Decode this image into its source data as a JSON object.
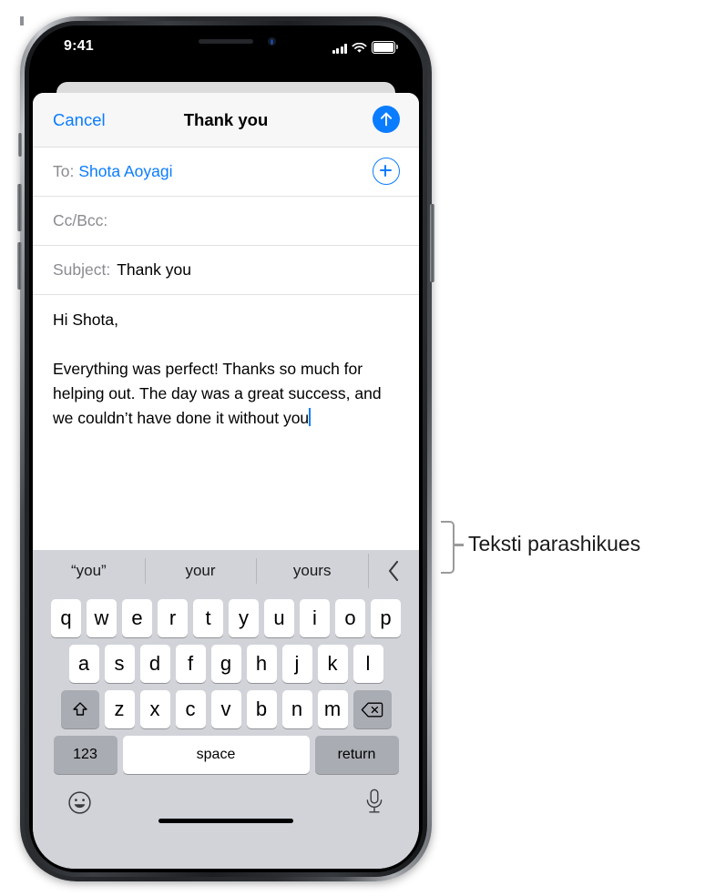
{
  "status_bar": {
    "time": "9:41",
    "signal_icon": "cellular-signal-icon",
    "wifi_icon": "wifi-icon",
    "battery_icon": "battery-icon"
  },
  "navbar": {
    "cancel_label": "Cancel",
    "title": "Thank you",
    "send_icon": "send-arrow-up-icon"
  },
  "fields": {
    "to_label": "To:",
    "to_value": "Shota Aoyagi",
    "add_contact_icon": "add-contact-plus-icon",
    "cc_label": "Cc/Bcc:",
    "cc_value": "",
    "subject_label": "Subject:",
    "subject_value": "Thank you"
  },
  "body": {
    "text": "Hi Shota,\n\nEverything was perfect! Thanks so much for helping out. The day was a great success, and we couldn’t have done it without you"
  },
  "keyboard": {
    "predictions": [
      "“you”",
      "your",
      "yours"
    ],
    "collapse_icon": "chevron-left-icon",
    "row1": [
      "q",
      "w",
      "e",
      "r",
      "t",
      "y",
      "u",
      "i",
      "o",
      "p"
    ],
    "row2": [
      "a",
      "s",
      "d",
      "f",
      "g",
      "h",
      "j",
      "k",
      "l"
    ],
    "row3": [
      "z",
      "x",
      "c",
      "v",
      "b",
      "n",
      "m"
    ],
    "shift_icon": "shift-arrow-up-icon",
    "delete_icon": "delete-backspace-icon",
    "numbers_label": "123",
    "space_label": "space",
    "return_label": "return",
    "emoji_icon": "emoji-smiley-icon",
    "dictation_icon": "microphone-icon"
  },
  "callout": {
    "label": "Teksti parashikues"
  },
  "colors": {
    "accent_blue": "#0a7cff",
    "keyboard_bg": "#d1d3d9",
    "key_fn_bg": "#a9acb3",
    "navbar_bg": "#f7f7f8"
  }
}
